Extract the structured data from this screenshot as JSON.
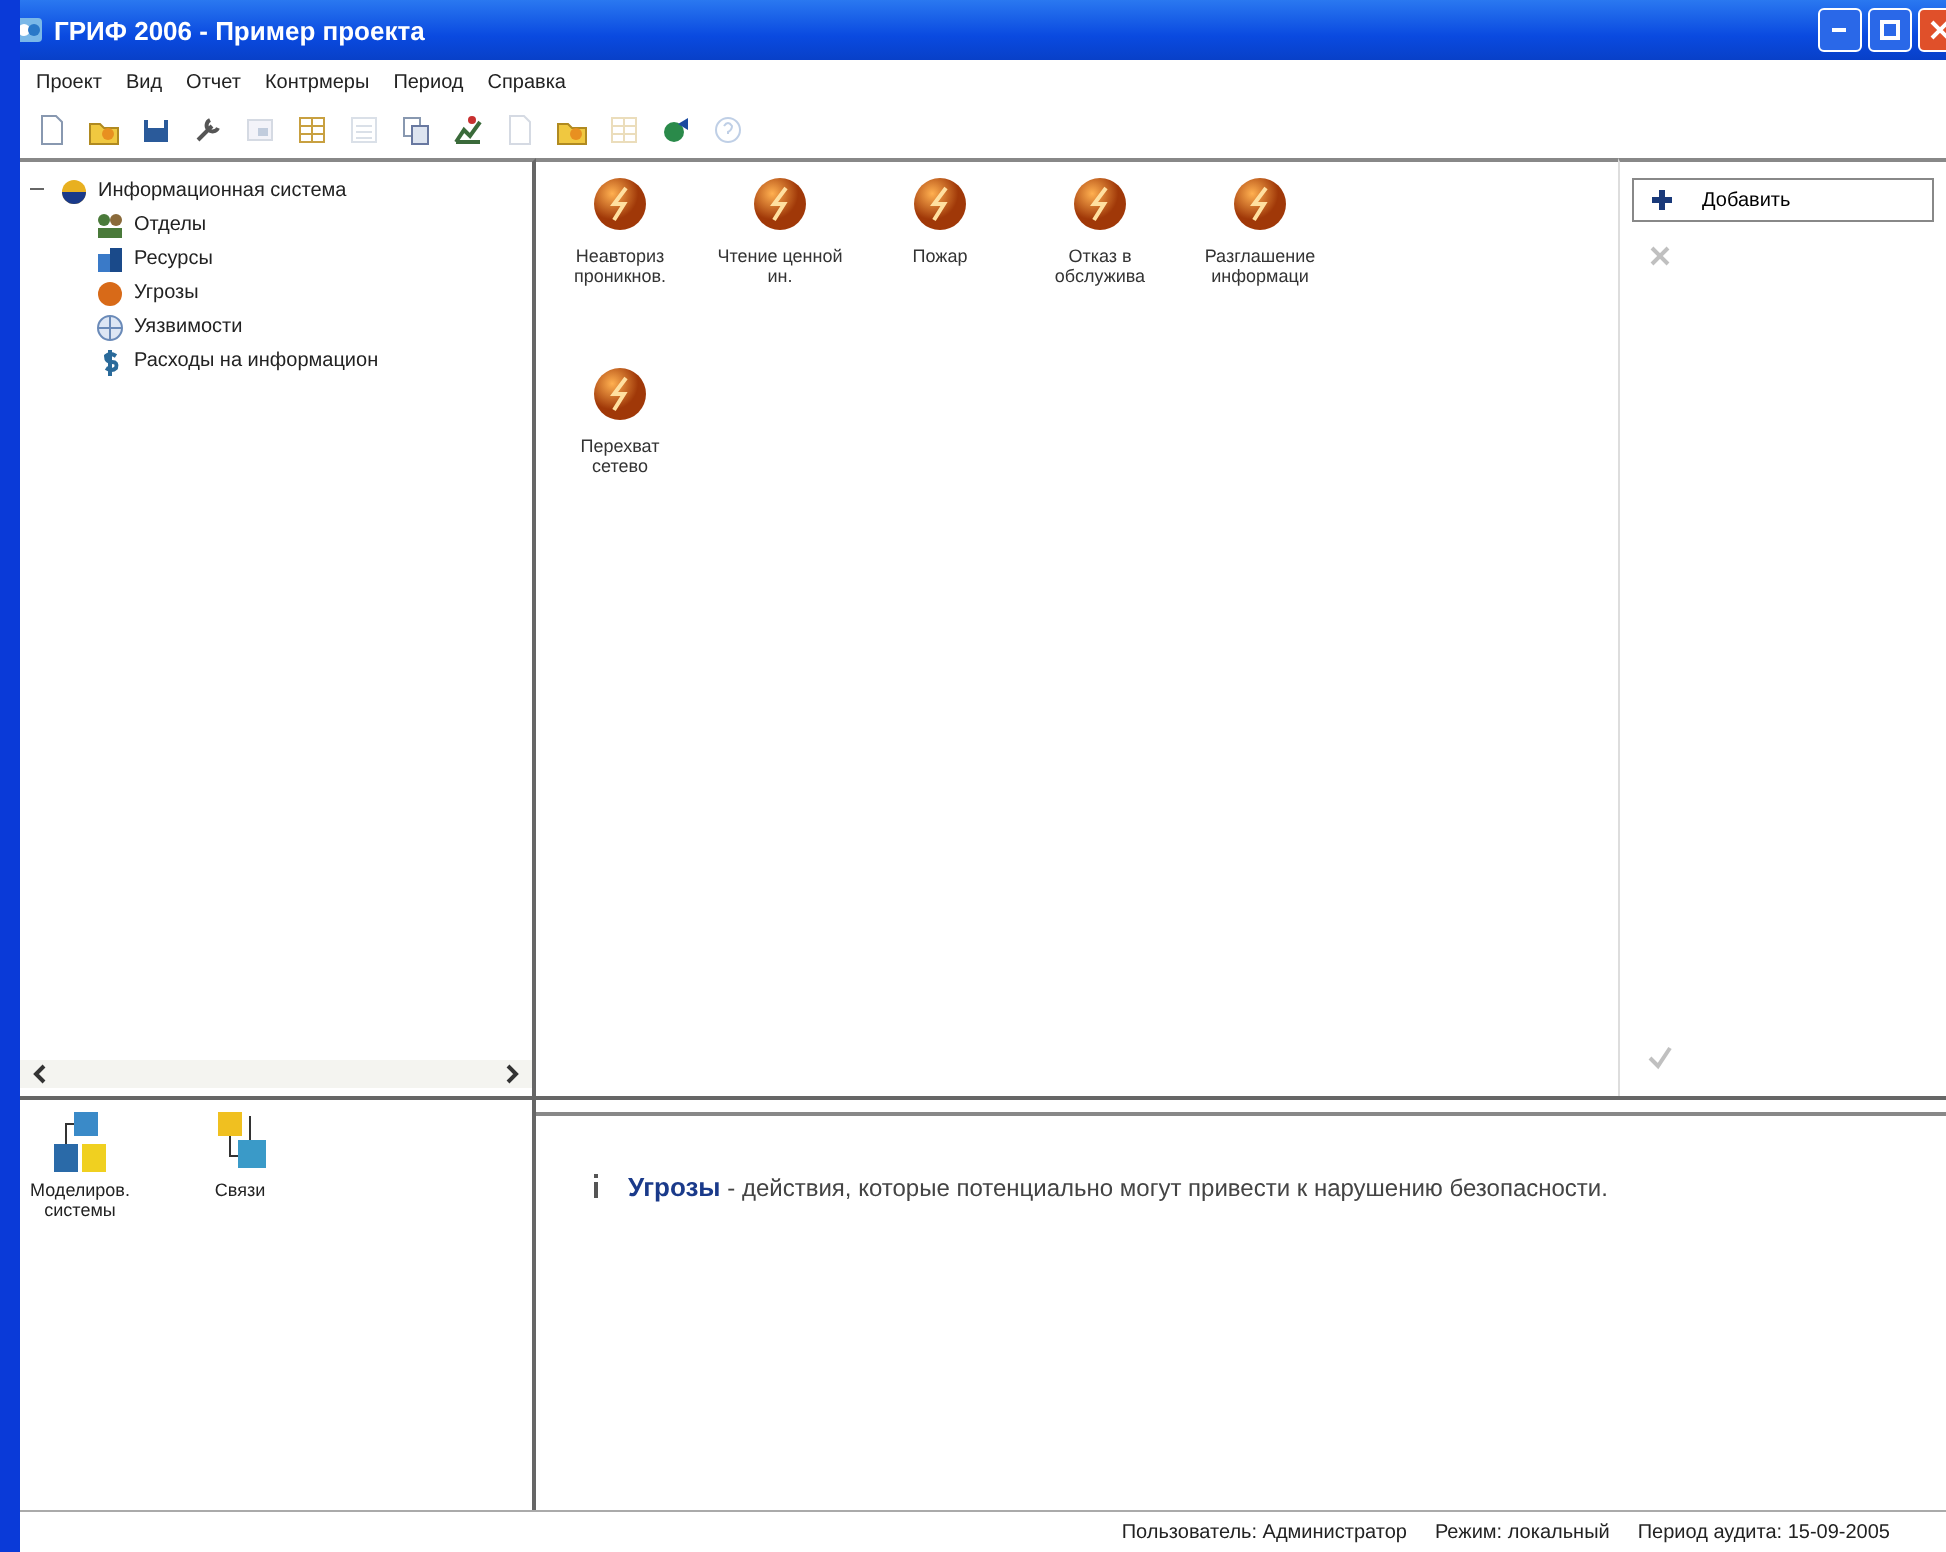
{
  "window": {
    "title": "ГРИФ 2006 - Пример проекта"
  },
  "menu": [
    "Проект",
    "Вид",
    "Отчет",
    "Контрмеры",
    "Период",
    "Справка"
  ],
  "toolbar": [
    {
      "kind": "page",
      "disabled": false
    },
    {
      "kind": "open",
      "disabled": false
    },
    {
      "kind": "save",
      "disabled": false
    },
    {
      "kind": "tool",
      "disabled": false
    },
    {
      "kind": "view",
      "disabled": true
    },
    {
      "kind": "grid",
      "disabled": false
    },
    {
      "kind": "list",
      "disabled": true
    },
    {
      "kind": "copy",
      "disabled": false
    },
    {
      "kind": "chart",
      "disabled": false
    },
    {
      "kind": "page",
      "disabled": true
    },
    {
      "kind": "open",
      "disabled": false
    },
    {
      "kind": "grid",
      "disabled": true
    },
    {
      "kind": "run",
      "disabled": false
    },
    {
      "kind": "help",
      "disabled": true
    }
  ],
  "tree": {
    "label": "Информационная система",
    "kind": "system",
    "expanded": true,
    "children": [
      {
        "label": "Отделы",
        "kind": "departments"
      },
      {
        "label": "Ресурсы",
        "kind": "resources"
      },
      {
        "label": "Угрозы",
        "kind": "threats"
      },
      {
        "label": "Уязвимости",
        "kind": "vulnerabilities"
      },
      {
        "label": "Расходы на информацион",
        "kind": "expenses"
      }
    ]
  },
  "threats": [
    {
      "label": "Неавториз проникнов."
    },
    {
      "label": "Чтение ценной ин."
    },
    {
      "label": "Пожар"
    },
    {
      "label": "Отказ в обслужива"
    },
    {
      "label": "Разглашение информаци"
    },
    {
      "label": "Перехват сетево"
    }
  ],
  "actions": [
    {
      "kind": "add",
      "label": "Добавить",
      "disabled": false
    },
    {
      "kind": "delete",
      "disabled": true
    },
    {
      "kind": "apply",
      "disabled": true
    }
  ],
  "shortcuts": [
    {
      "kind": "model",
      "label": "Моделиров. системы"
    },
    {
      "kind": "links",
      "label": "Связи"
    }
  ],
  "info": "**Угрозы** - действия, которые потенциально могут привести к нарушению безопасности.",
  "status_bar": [
    "Пользователь: Администратор",
    "Режим: локальный",
    "Период аудита: 15-09-2005"
  ]
}
